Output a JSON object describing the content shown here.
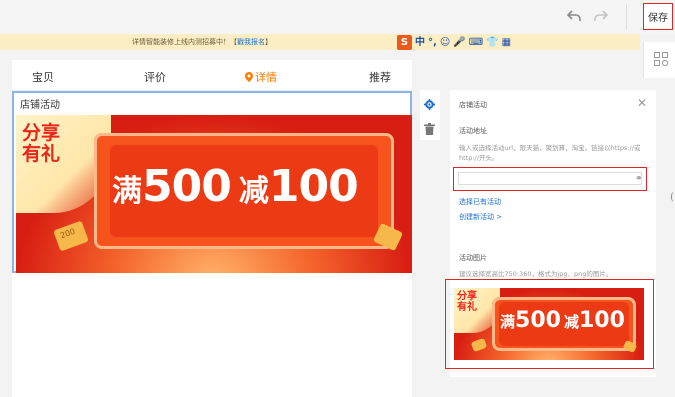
{
  "toolbar": {
    "undo_icon": "undo-arrow",
    "redo_icon": "redo-arrow",
    "save_label": "保存"
  },
  "notice": {
    "text": "详情智能装修上线内测招募中！【",
    "link": "戳我报名",
    "text_end": "】"
  },
  "ime": {
    "logo": "S",
    "items": [
      "中",
      "°,",
      "☺",
      "🎤",
      "⌨",
      "👕",
      "▦"
    ]
  },
  "preview": {
    "tabs": [
      "宝贝",
      "评价",
      "详情",
      "推荐"
    ],
    "active_tab": "详情",
    "module_title": "店铺活动",
    "banner": {
      "gift_text": "分享\n有礼",
      "deal_prefix": "满",
      "deal_amount": "500",
      "deal_mid": "减",
      "deal_discount": "100",
      "coin_label": "200"
    }
  },
  "panel": {
    "title": "店铺活动",
    "close_icon": "close",
    "activity_url_label": "活动地址",
    "activity_url_hint": "输入或选择活动url，限天猫，聚划算，淘宝。链接以https://或http://开头。",
    "activity_url_value": "",
    "select_existing": "选择已有活动",
    "create_new": "创建新活动 >",
    "image_label": "活动图片",
    "image_hint": "建议选择宽高比750:360，格式为jpg、png的图片。"
  },
  "colors": {
    "accent_red": "#e0242a",
    "link_blue": "#1a6fd3",
    "active_orange": "#ff7a00",
    "banner_red": "#e02a1c"
  }
}
